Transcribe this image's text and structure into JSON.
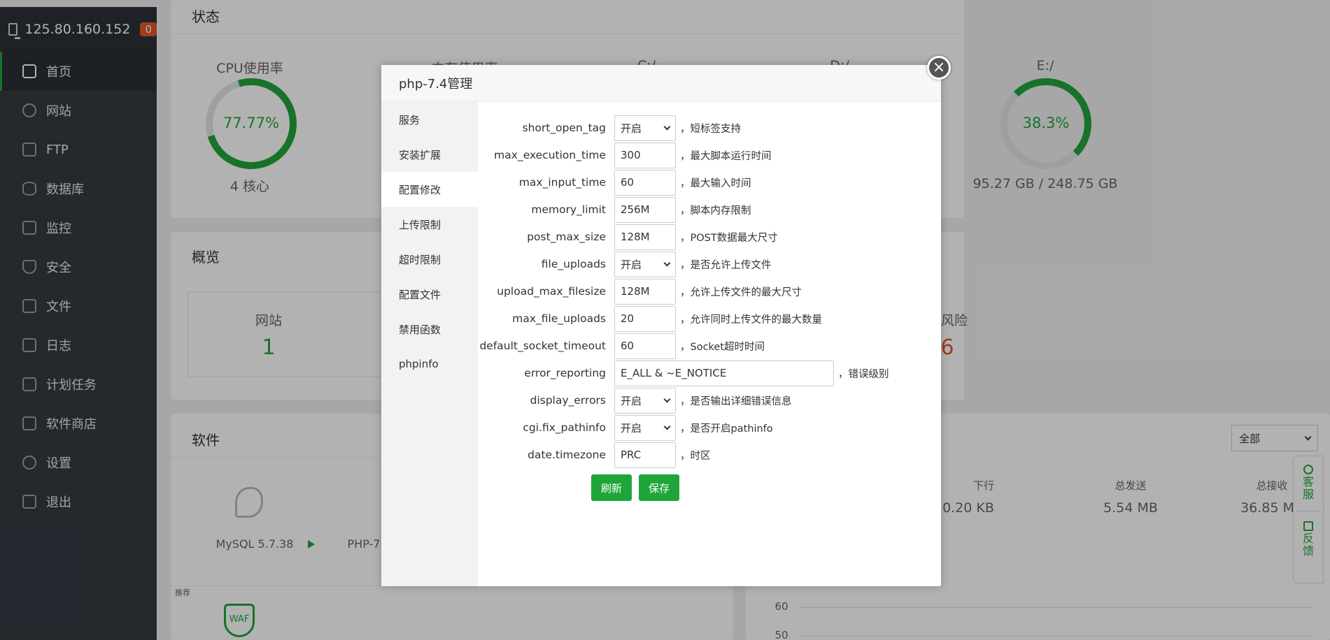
{
  "sidebar": {
    "ip": "125.80.160.152",
    "badge": "0",
    "items": [
      {
        "label": "首页"
      },
      {
        "label": "网站"
      },
      {
        "label": "FTP"
      },
      {
        "label": "数据库"
      },
      {
        "label": "监控"
      },
      {
        "label": "安全"
      },
      {
        "label": "文件"
      },
      {
        "label": "日志"
      },
      {
        "label": "计划任务"
      },
      {
        "label": "软件商店"
      },
      {
        "label": "设置"
      },
      {
        "label": "退出"
      }
    ]
  },
  "status": {
    "title": "状态",
    "cpu_label": "CPU使用率",
    "cpu_value": "77.77%",
    "cpu_cores": "4 核心",
    "mem_label": "内存使用率",
    "c_label": "C:/",
    "d_label": "D:/",
    "e_label": "E:/",
    "e_value": "38.3%",
    "e_size": "95.27 GB / 248.75 GB"
  },
  "overview": {
    "title": "概览",
    "site_label": "网站",
    "site_value": "1",
    "risk_label": "风险",
    "risk_value": "6"
  },
  "software": {
    "title": "软件",
    "mysql": "MySQL 5.7.38",
    "php": "PHP-7",
    "recommend": "推荐",
    "waf": "WAF"
  },
  "traffic": {
    "select": "全部",
    "down_label": "下行",
    "down_value": "0.20 KB",
    "sent_label": "总发送",
    "sent_value": "5.54 MB",
    "recv_label": "总接收",
    "recv_value": "36.85 MB",
    "tick_60": "60",
    "tick_50": "50"
  },
  "float": {
    "service": "客服",
    "feedback": "反馈"
  },
  "modal": {
    "title": "php-7.4管理",
    "close": "×",
    "nav": [
      {
        "label": "服务"
      },
      {
        "label": "安装扩展"
      },
      {
        "label": "配置修改"
      },
      {
        "label": "上传限制"
      },
      {
        "label": "超时限制"
      },
      {
        "label": "配置文件"
      },
      {
        "label": "禁用函数"
      },
      {
        "label": "phpinfo"
      }
    ],
    "rows": [
      {
        "label": "short_open_tag",
        "value": "开启",
        "desc": "，短标签支持"
      },
      {
        "label": "max_execution_time",
        "value": "300",
        "desc": "，最大脚本运行时间"
      },
      {
        "label": "max_input_time",
        "value": "60",
        "desc": "，最大输入时间"
      },
      {
        "label": "memory_limit",
        "value": "256M",
        "desc": "，脚本内存限制"
      },
      {
        "label": "post_max_size",
        "value": "128M",
        "desc": "，POST数据最大尺寸"
      },
      {
        "label": "file_uploads",
        "value": "开启",
        "desc": "，是否允许上传文件"
      },
      {
        "label": "upload_max_filesize",
        "value": "128M",
        "desc": "，允许上传文件的最大尺寸"
      },
      {
        "label": "max_file_uploads",
        "value": "20",
        "desc": "，允许同时上传文件的最大数量"
      },
      {
        "label": "default_socket_timeout",
        "value": "60",
        "desc": "，Socket超时时间"
      },
      {
        "label": "error_reporting",
        "value": "E_ALL & ~E_NOTICE",
        "desc": "，错误级别"
      },
      {
        "label": "display_errors",
        "value": "开启",
        "desc": "，是否输出详细错误信息"
      },
      {
        "label": "cgi.fix_pathinfo",
        "value": "开启",
        "desc": "，是否开启pathinfo"
      },
      {
        "label": "date.timezone",
        "value": "PRC",
        "desc": "，时区"
      }
    ],
    "refresh_label": "刷新",
    "save_label": "保存"
  }
}
